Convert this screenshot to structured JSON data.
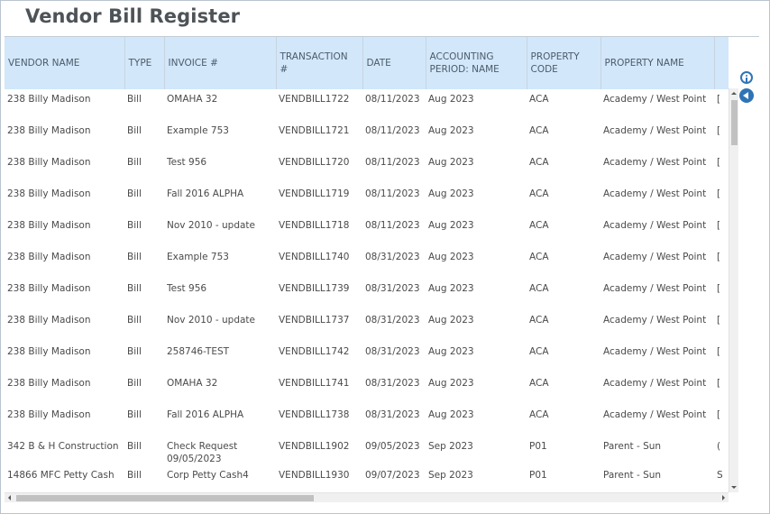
{
  "page": {
    "title": "Vendor Bill Register"
  },
  "colors": {
    "header_bg": "#d2e7fa",
    "accent": "#2f74b5",
    "title": "#4d5357"
  },
  "icons": {
    "info": "info-icon",
    "collapse": "chevron-left-icon"
  },
  "table": {
    "columns": [
      "VENDOR NAME",
      "TYPE",
      "INVOICE #",
      "TRANSACTION #",
      "DATE",
      "ACCOUNTING PERIOD: NAME",
      "PROPERTY CODE",
      "PROPERTY NAME",
      ""
    ],
    "rows": [
      [
        "238 Billy Madison",
        "Bill",
        "OMAHA 32",
        "VENDBILL1722",
        "08/11/2023",
        "Aug 2023",
        "ACA",
        "Academy / West Point",
        "["
      ],
      [
        "238 Billy Madison",
        "Bill",
        "Example 753",
        "VENDBILL1721",
        "08/11/2023",
        "Aug 2023",
        "ACA",
        "Academy / West Point",
        "["
      ],
      [
        "238 Billy Madison",
        "Bill",
        "Test 956",
        "VENDBILL1720",
        "08/11/2023",
        "Aug 2023",
        "ACA",
        "Academy / West Point",
        "["
      ],
      [
        "238 Billy Madison",
        "Bill",
        "Fall 2016 ALPHA",
        "VENDBILL1719",
        "08/11/2023",
        "Aug 2023",
        "ACA",
        "Academy / West Point",
        "["
      ],
      [
        "238 Billy Madison",
        "Bill",
        "Nov 2010 - update",
        "VENDBILL1718",
        "08/11/2023",
        "Aug 2023",
        "ACA",
        "Academy / West Point",
        "["
      ],
      [
        "238 Billy Madison",
        "Bill",
        "Example 753",
        "VENDBILL1740",
        "08/31/2023",
        "Aug 2023",
        "ACA",
        "Academy / West Point",
        "["
      ],
      [
        "238 Billy Madison",
        "Bill",
        "Test 956",
        "VENDBILL1739",
        "08/31/2023",
        "Aug 2023",
        "ACA",
        "Academy / West Point",
        "["
      ],
      [
        "238 Billy Madison",
        "Bill",
        "Nov 2010 - update",
        "VENDBILL1737",
        "08/31/2023",
        "Aug 2023",
        "ACA",
        "Academy / West Point",
        "["
      ],
      [
        "238 Billy Madison",
        "Bill",
        "258746-TEST",
        "VENDBILL1742",
        "08/31/2023",
        "Aug 2023",
        "ACA",
        "Academy / West Point",
        "["
      ],
      [
        "238 Billy Madison",
        "Bill",
        "OMAHA 32",
        "VENDBILL1741",
        "08/31/2023",
        "Aug 2023",
        "ACA",
        "Academy / West Point",
        "["
      ],
      [
        "238 Billy Madison",
        "Bill",
        "Fall 2016 ALPHA",
        "VENDBILL1738",
        "08/31/2023",
        "Aug 2023",
        "ACA",
        "Academy / West Point",
        "["
      ],
      [
        "342 B & H Construction",
        "Bill",
        "Check Request 09/05/2023",
        "VENDBILL1902",
        "09/05/2023",
        "Sep 2023",
        "P01",
        "Parent - Sun",
        "("
      ],
      [
        "14866 MFC Petty Cash",
        "Bill",
        "Corp Petty Cash4",
        "VENDBILL1930",
        "09/07/2023",
        "Sep 2023",
        "P01",
        "Parent - Sun",
        "S"
      ]
    ]
  }
}
